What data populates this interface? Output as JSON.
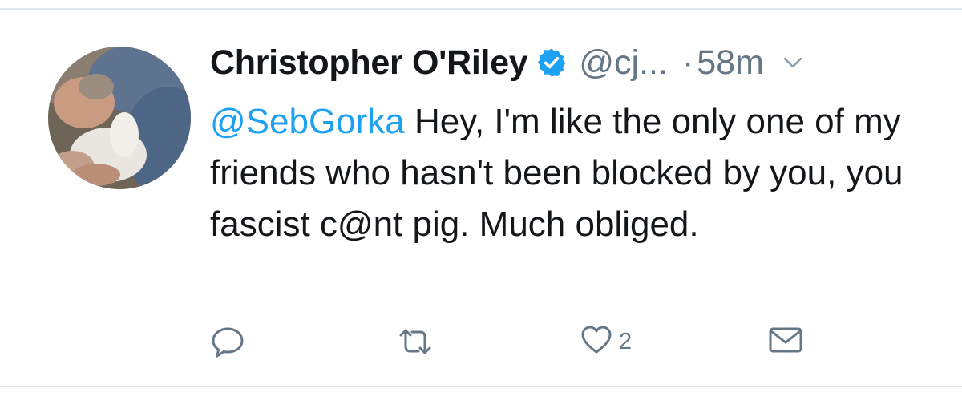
{
  "tweet": {
    "author": {
      "display_name": "Christopher O'Riley",
      "handle": "@cj...",
      "verified": true
    },
    "separator": "·",
    "time": "58m",
    "mention": "@SebGorka",
    "text": " Hey, I'm like the only one of my friends who hasn't been blocked by you, you fascist c@nt pig. Much obliged.",
    "actions": {
      "reply_icon": "reply-icon",
      "retweet_icon": "retweet-icon",
      "like_icon": "heart-icon",
      "like_count": "2",
      "dm_icon": "envelope-icon"
    },
    "colors": {
      "mention": "#1da1f2",
      "verified": "#1da1f2",
      "secondary": "#657786"
    }
  }
}
